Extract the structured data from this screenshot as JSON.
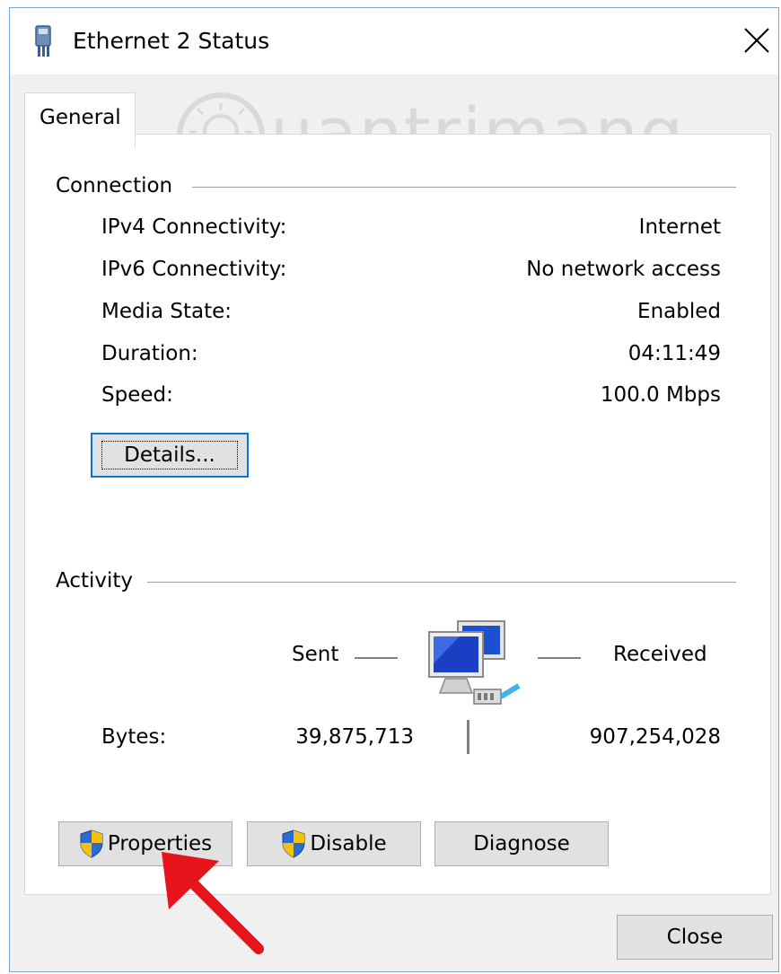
{
  "window": {
    "title": "Ethernet 2 Status"
  },
  "tabs": [
    {
      "label": "General"
    }
  ],
  "watermark": {
    "text": "uantrimang"
  },
  "connection": {
    "heading": "Connection",
    "rows": [
      {
        "label": "IPv4 Connectivity:",
        "value": "Internet"
      },
      {
        "label": "IPv6 Connectivity:",
        "value": "No network access"
      },
      {
        "label": "Media State:",
        "value": "Enabled"
      },
      {
        "label": "Duration:",
        "value": "04:11:49"
      },
      {
        "label": "Speed:",
        "value": "100.0 Mbps"
      }
    ],
    "details_button": "Details..."
  },
  "activity": {
    "heading": "Activity",
    "sent_label": "Sent",
    "received_label": "Received",
    "bytes_label": "Bytes:",
    "bytes_sent": "39,875,713",
    "bytes_received": "907,254,028"
  },
  "buttons": {
    "properties": "Properties",
    "disable": "Disable",
    "diagnose": "Diagnose",
    "close": "Close"
  },
  "colors": {
    "focus": "#0078d7",
    "arrow": "#e8141c",
    "window_border": "#7aa7d6"
  },
  "icons": [
    "ethernet-connector-icon",
    "close-icon",
    "network-computers-icon",
    "uac-shield-icon",
    "lightbulb-logo-icon",
    "red-arrow-annotation"
  ]
}
